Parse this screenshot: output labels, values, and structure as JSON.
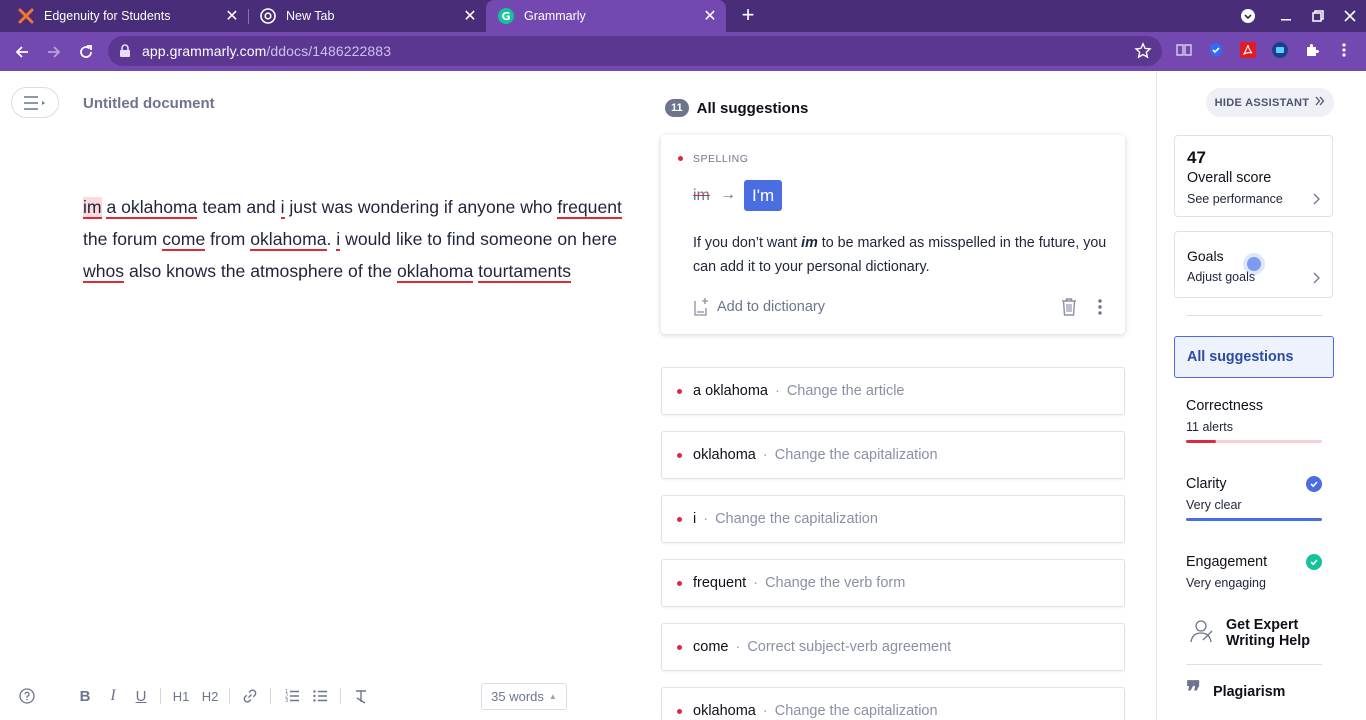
{
  "browser": {
    "tabs": [
      {
        "title": "Edgenuity for Students",
        "icon": "edgenuity-icon"
      },
      {
        "title": "New Tab",
        "icon": "chrome-icon"
      },
      {
        "title": "Grammarly",
        "icon": "grammarly-icon"
      }
    ],
    "url_host": "app.grammarly.com",
    "url_path": "/ddocs/1486222883"
  },
  "editor": {
    "title": "Untitled document",
    "text": {
      "w1": "im",
      "t1": " ",
      "w2": "a oklahoma",
      "t2": " team and ",
      "w3": "i",
      "t3": " just was wondering if anyone who ",
      "w4": "frequent",
      "t4": " the forum ",
      "w5": "come",
      "t5": " from ",
      "w6": "oklahoma",
      "t6": ". ",
      "w7": "i",
      "t7": " would like to find someone on here ",
      "w8": "whos",
      "t8": " also knows the atmosphere of the ",
      "w9": "oklahoma",
      "t9": " ",
      "w10": "tourtaments"
    },
    "toolbar": {
      "bold": "B",
      "italic": "I",
      "underline": "U",
      "h1": "H1",
      "h2": "H2"
    },
    "word_count": "35 words"
  },
  "suggestions": {
    "count": "11",
    "heading": "All suggestions",
    "active": {
      "kind": "SPELLING",
      "original": "im",
      "replacement": "I'm",
      "explain_pre": "If you don’t want ",
      "explain_word": "im",
      "explain_post": " to be marked as misspelled in the future, you can add it to your personal dictionary.",
      "add_dictionary": "Add to dictionary"
    },
    "items": [
      {
        "word": "a oklahoma",
        "desc": "Change the article"
      },
      {
        "word": "oklahoma",
        "desc": "Change the capitalization"
      },
      {
        "word": "i",
        "desc": "Change the capitalization"
      },
      {
        "word": "frequent",
        "desc": "Change the verb form"
      },
      {
        "word": "come",
        "desc": "Correct subject-verb agreement"
      },
      {
        "word": "oklahoma",
        "desc": "Change the capitalization"
      }
    ],
    "separator": "·"
  },
  "sidebar": {
    "hide_assistant": "HIDE ASSISTANT",
    "score": "47",
    "score_label": "Overall score",
    "see_performance": "See performance",
    "goals_title": "Goals",
    "adjust_goals": "Adjust goals",
    "all_suggestions": "All suggestions",
    "categories": [
      {
        "name": "Correctness",
        "sub": "11 alerts",
        "progress": 0.22,
        "color": "#dc2a3d"
      },
      {
        "name": "Clarity",
        "sub": "Very clear",
        "progress": 1.0,
        "color": "#4a6ee0"
      },
      {
        "name": "Engagement",
        "sub": "Very engaging",
        "progress": 1.0,
        "color": "#15c39a"
      }
    ],
    "expert_help": "Get Expert Writing Help",
    "plagiarism": "Plagiarism"
  }
}
